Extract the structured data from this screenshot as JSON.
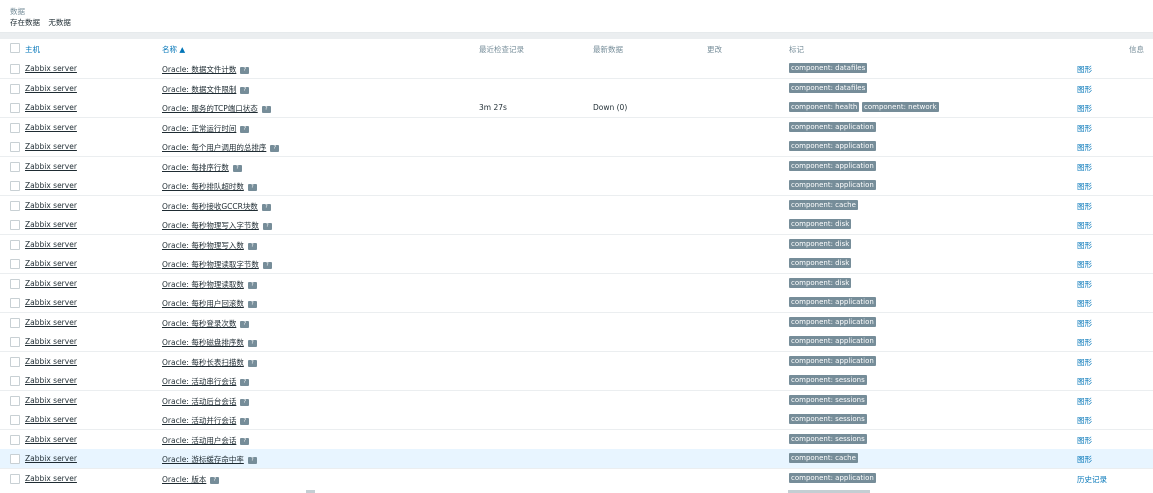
{
  "filter": {
    "label": "数据",
    "options": [
      "存在数据",
      "无数据"
    ]
  },
  "table": {
    "headers": {
      "host": "主机",
      "name": "名称 ▲",
      "last_check": "最近检查记录",
      "last_value": "最新数据",
      "change": "更改",
      "tags": "标记",
      "info": "信息"
    },
    "rows": [
      {
        "host": "Zabbix server",
        "name": "Oracle: 数据文件计数",
        "last_check": "",
        "last_value": "",
        "tags": [
          "component: datafiles"
        ],
        "action": "图形"
      },
      {
        "host": "Zabbix server",
        "name": "Oracle: 数据文件限制",
        "last_check": "",
        "last_value": "",
        "tags": [
          "component: datafiles"
        ],
        "action": "图形"
      },
      {
        "host": "Zabbix server",
        "name": "Oracle: 服务的TCP端口状态",
        "last_check": "3m 27s",
        "last_value": "Down (0)",
        "tags": [
          "component: health",
          "component: network"
        ],
        "action": "图形"
      },
      {
        "host": "Zabbix server",
        "name": "Oracle: 正常运行时间",
        "last_check": "",
        "last_value": "",
        "tags": [
          "component: application"
        ],
        "action": "图形"
      },
      {
        "host": "Zabbix server",
        "name": "Oracle: 每个用户调用的总排序",
        "last_check": "",
        "last_value": "",
        "tags": [
          "component: application"
        ],
        "action": "图形"
      },
      {
        "host": "Zabbix server",
        "name": "Oracle: 每排序行数",
        "last_check": "",
        "last_value": "",
        "tags": [
          "component: application"
        ],
        "action": "图形"
      },
      {
        "host": "Zabbix server",
        "name": "Oracle: 每秒排队超时数",
        "last_check": "",
        "last_value": "",
        "tags": [
          "component: application"
        ],
        "action": "图形"
      },
      {
        "host": "Zabbix server",
        "name": "Oracle: 每秒接收GCCR块数",
        "last_check": "",
        "last_value": "",
        "tags": [
          "component: cache"
        ],
        "action": "图形"
      },
      {
        "host": "Zabbix server",
        "name": "Oracle: 每秒物理写入字节数",
        "last_check": "",
        "last_value": "",
        "tags": [
          "component: disk"
        ],
        "action": "图形"
      },
      {
        "host": "Zabbix server",
        "name": "Oracle: 每秒物理写入数",
        "last_check": "",
        "last_value": "",
        "tags": [
          "component: disk"
        ],
        "action": "图形"
      },
      {
        "host": "Zabbix server",
        "name": "Oracle: 每秒物理读取字节数",
        "last_check": "",
        "last_value": "",
        "tags": [
          "component: disk"
        ],
        "action": "图形"
      },
      {
        "host": "Zabbix server",
        "name": "Oracle: 每秒物理读取数",
        "last_check": "",
        "last_value": "",
        "tags": [
          "component: disk"
        ],
        "action": "图形"
      },
      {
        "host": "Zabbix server",
        "name": "Oracle: 每秒用户回滚数",
        "last_check": "",
        "last_value": "",
        "tags": [
          "component: application"
        ],
        "action": "图形"
      },
      {
        "host": "Zabbix server",
        "name": "Oracle: 每秒登录次数",
        "last_check": "",
        "last_value": "",
        "tags": [
          "component: application"
        ],
        "action": "图形"
      },
      {
        "host": "Zabbix server",
        "name": "Oracle: 每秒磁盘排序数",
        "last_check": "",
        "last_value": "",
        "tags": [
          "component: application"
        ],
        "action": "图形"
      },
      {
        "host": "Zabbix server",
        "name": "Oracle: 每秒长表扫描数",
        "last_check": "",
        "last_value": "",
        "tags": [
          "component: application"
        ],
        "action": "图形"
      },
      {
        "host": "Zabbix server",
        "name": "Oracle: 活动串行会话",
        "last_check": "",
        "last_value": "",
        "tags": [
          "component: sessions"
        ],
        "action": "图形"
      },
      {
        "host": "Zabbix server",
        "name": "Oracle: 活动后台会话",
        "last_check": "",
        "last_value": "",
        "tags": [
          "component: sessions"
        ],
        "action": "图形"
      },
      {
        "host": "Zabbix server",
        "name": "Oracle: 活动并行会话",
        "last_check": "",
        "last_value": "",
        "tags": [
          "component: sessions"
        ],
        "action": "图形"
      },
      {
        "host": "Zabbix server",
        "name": "Oracle: 活动用户会话",
        "last_check": "",
        "last_value": "",
        "tags": [
          "component: sessions"
        ],
        "action": "图形"
      },
      {
        "host": "Zabbix server",
        "name": "Oracle: 游标缓存命中率",
        "last_check": "",
        "last_value": "",
        "tags": [
          "component: cache"
        ],
        "action": "图形",
        "highlighted": true
      },
      {
        "host": "Zabbix server",
        "name": "Oracle: 版本",
        "last_check": "",
        "last_value": "",
        "tags": [
          "component: application"
        ],
        "action": "历史记录"
      }
    ]
  },
  "icons": {
    "description": "description-icon",
    "checkbox": "checkbox-icon"
  },
  "colors": {
    "link": "#0275b8",
    "tag_bg": "#768d99",
    "highlight_row": "#e8f5ff"
  }
}
